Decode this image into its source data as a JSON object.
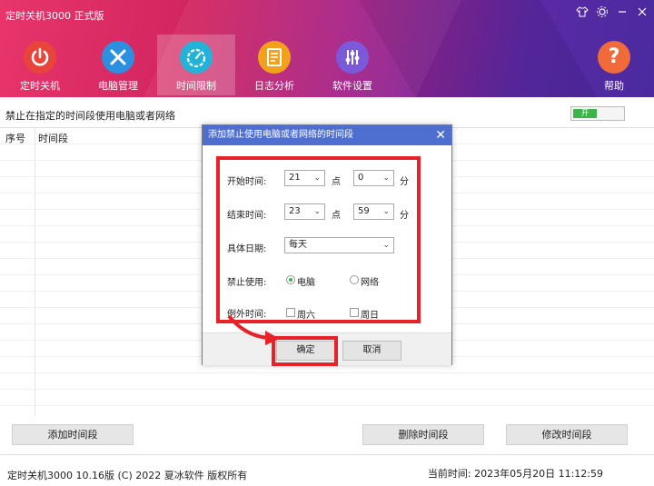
{
  "window": {
    "title": "定时关机3000 正式版",
    "controls": [
      "skin-icon",
      "settings-icon",
      "minimize-icon",
      "close-icon"
    ]
  },
  "nav": {
    "items": [
      {
        "label": "定时关机",
        "icon": "power-icon",
        "color": "#e8443a"
      },
      {
        "label": "电脑管理",
        "icon": "tools-icon",
        "color": "#2c8fe0"
      },
      {
        "label": "时间限制",
        "icon": "timer-icon",
        "color": "#23b3d9",
        "active": true
      },
      {
        "label": "日志分析",
        "icon": "log-icon",
        "color": "#f2a21a"
      },
      {
        "label": "软件设置",
        "icon": "settings-icon",
        "color": "#7a5ad8"
      }
    ],
    "help": {
      "label": "帮助",
      "icon": "help-icon",
      "color": "#f06a3a"
    }
  },
  "main": {
    "heading": "禁止在指定的时间段使用电脑或者网络",
    "toggle_label": "开",
    "table": {
      "columns": [
        "序号",
        "时间段"
      ]
    },
    "buttons": {
      "add": "添加时间段",
      "delete": "删除时间段",
      "modify": "修改时间段"
    }
  },
  "dialog": {
    "title": "添加禁止使用电脑或者网络的时间段",
    "start_label": "开始时间:",
    "start_hour": "21",
    "start_minute": "0",
    "end_label": "结束时间:",
    "end_hour": "23",
    "end_minute": "59",
    "hour_unit": "点",
    "minute_unit": "分",
    "date_label": "具体日期:",
    "date_value": "每天",
    "forbid_label": "禁止使用:",
    "forbid_options": [
      "电脑",
      "网络"
    ],
    "forbid_selected": "电脑",
    "except_label": "例外时间:",
    "except_options": [
      "周六",
      "周日"
    ],
    "ok": "确定",
    "cancel": "取消",
    "highlight_color": "#e8222a"
  },
  "status": {
    "left": "定时关机3000 10.16版 (C) 2022  夏冰软件 版权所有",
    "right": "当前时间: 2023年05月20日 11:12:59"
  }
}
